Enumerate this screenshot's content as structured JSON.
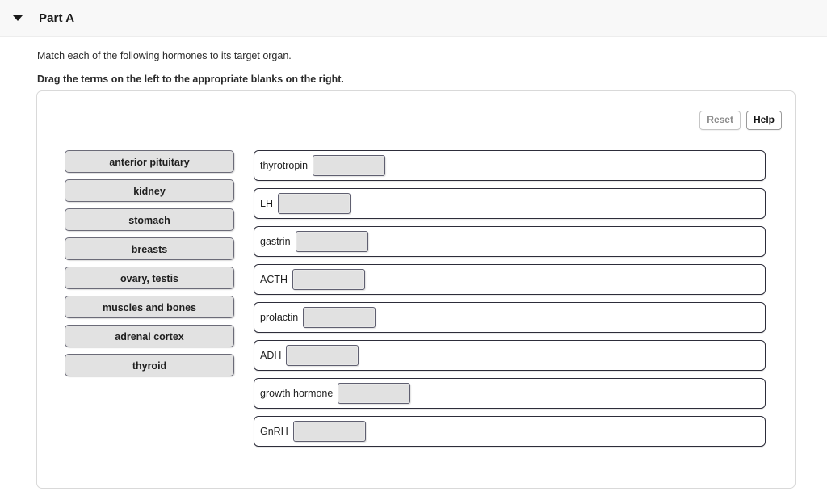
{
  "header": {
    "caret_icon": "chevron-down-icon",
    "title": "Part A"
  },
  "prompt": {
    "line1": "Match each of the following hormones to its target organ.",
    "line2": "Drag the terms on the left to the appropriate blanks on the right."
  },
  "toolbar": {
    "reset_label": "Reset",
    "help_label": "Help",
    "reset_state": "disabled",
    "help_state": "active"
  },
  "term_bank": {
    "items": [
      {
        "label": "anterior pituitary"
      },
      {
        "label": "kidney"
      },
      {
        "label": "stomach"
      },
      {
        "label": "breasts"
      },
      {
        "label": "ovary, testis"
      },
      {
        "label": "muscles and bones"
      },
      {
        "label": "adrenal cortex"
      },
      {
        "label": "thyroid"
      }
    ]
  },
  "drop_zones": {
    "rows": [
      {
        "label": "thyrotropin",
        "blank_value": "",
        "blank_width": 90
      },
      {
        "label": "LH",
        "blank_value": "",
        "blank_width": 90
      },
      {
        "label": "gastrin",
        "blank_value": "",
        "blank_width": 90
      },
      {
        "label": "ACTH",
        "blank_value": "",
        "blank_width": 90
      },
      {
        "label": "prolactin",
        "blank_value": "",
        "blank_width": 90
      },
      {
        "label": "ADH",
        "blank_value": "",
        "blank_width": 90
      },
      {
        "label": "growth hormone",
        "blank_value": "",
        "blank_width": 90
      },
      {
        "label": "GnRH",
        "blank_value": "",
        "blank_width": 90
      }
    ]
  },
  "colors": {
    "header_bar": "#f8f8f8",
    "term_chip_fill": "#e2e2e2",
    "blank_fill": "#e1e1e1",
    "row_border": "#2d2d3a",
    "panel_border": "#d9d9d9",
    "disabled_text": "#8a8a8a"
  }
}
